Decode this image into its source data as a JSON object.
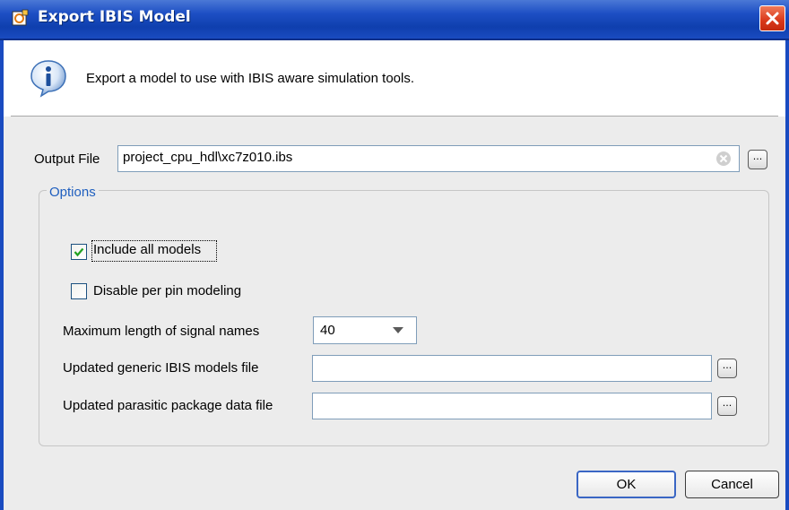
{
  "dialog": {
    "title": "Export IBIS Model",
    "description": "Export a model to use with IBIS aware simulation tools."
  },
  "output_file": {
    "label": "Output File",
    "value": "project_cpu_hdl\\xc7z010.ibs",
    "browse_label": "..."
  },
  "options": {
    "group_title": "Options",
    "include_all_models": {
      "label": "Include all models",
      "checked": true
    },
    "disable_per_pin": {
      "label": "Disable per pin modeling",
      "checked": false
    },
    "max_length": {
      "label": "Maximum length of signal names",
      "value": "40"
    },
    "generic_ibis": {
      "label": "Updated generic IBIS models file",
      "value": "",
      "browse_label": "..."
    },
    "parasitic_pkg": {
      "label": "Updated parasitic package data file",
      "value": "",
      "browse_label": "..."
    }
  },
  "buttons": {
    "ok": "OK",
    "cancel": "Cancel"
  },
  "colors": {
    "titlebar": "#0f3fae",
    "accent": "#1f5fbf",
    "close": "#d9381a"
  }
}
